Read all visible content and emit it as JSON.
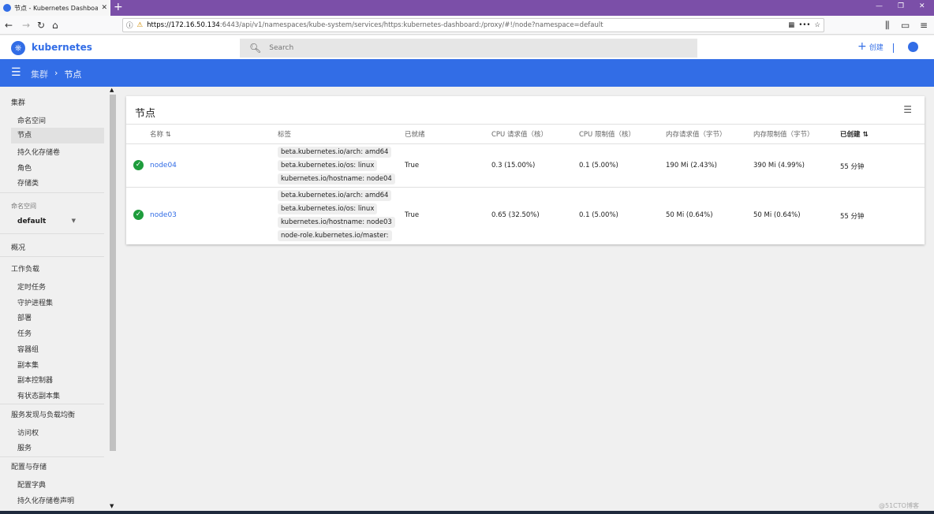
{
  "browser": {
    "tab_title": "节点 - Kubernetes Dashboard",
    "url_host": "https://172.16.50.134",
    "url_rest": ":6443/api/v1/namespaces/kube-system/services/https:kubernetes-dashboard:/proxy/#!/node?namespace=default"
  },
  "app": {
    "brand": "kubernetes",
    "search_placeholder": "Search",
    "create_label": "创建"
  },
  "toolbar": {
    "crumb_parent": "集群",
    "crumb_current": "节点"
  },
  "sidebar": {
    "cluster_heading": "集群",
    "cluster_items": [
      "命名空间",
      "节点",
      "持久化存储卷",
      "角色",
      "存储类"
    ],
    "namespace_label": "命名空间",
    "namespace_value": "default",
    "overview": "概况",
    "workload_heading": "工作负载",
    "workload_items": [
      "定时任务",
      "守护进程集",
      "部署",
      "任务",
      "容器组",
      "副本集",
      "副本控制器",
      "有状态副本集"
    ],
    "discovery_heading": "服务发现与负载均衡",
    "discovery_items": [
      "访问权",
      "服务"
    ],
    "config_heading": "配置与存储",
    "config_items": [
      "配置字典",
      "持久化存储卷声明"
    ]
  },
  "card": {
    "title": "节点",
    "columns": [
      "名称",
      "标签",
      "已就绪",
      "CPU 请求值（核）",
      "CPU 限制值（核）",
      "内存请求值（字节）",
      "内存限制值（字节）",
      "已创建"
    ]
  },
  "nodes": [
    {
      "name": "node04",
      "labels": [
        "beta.kubernetes.io/arch: amd64",
        "beta.kubernetes.io/os: linux",
        "kubernetes.io/hostname: node04"
      ],
      "ready": "True",
      "cpu_req": "0.3 (15.00%)",
      "cpu_lim": "0.1 (5.00%)",
      "mem_req": "190 Mi (2.43%)",
      "mem_lim": "390 Mi (4.99%)",
      "created": "55 分钟"
    },
    {
      "name": "node03",
      "labels": [
        "beta.kubernetes.io/arch: amd64",
        "beta.kubernetes.io/os: linux",
        "kubernetes.io/hostname: node03",
        "node-role.kubernetes.io/master:"
      ],
      "ready": "True",
      "cpu_req": "0.65 (32.50%)",
      "cpu_lim": "0.1 (5.00%)",
      "mem_req": "50 Mi (0.64%)",
      "mem_lim": "50 Mi (0.64%)",
      "created": "55 分钟"
    }
  ],
  "watermark": "@51CTO博客"
}
